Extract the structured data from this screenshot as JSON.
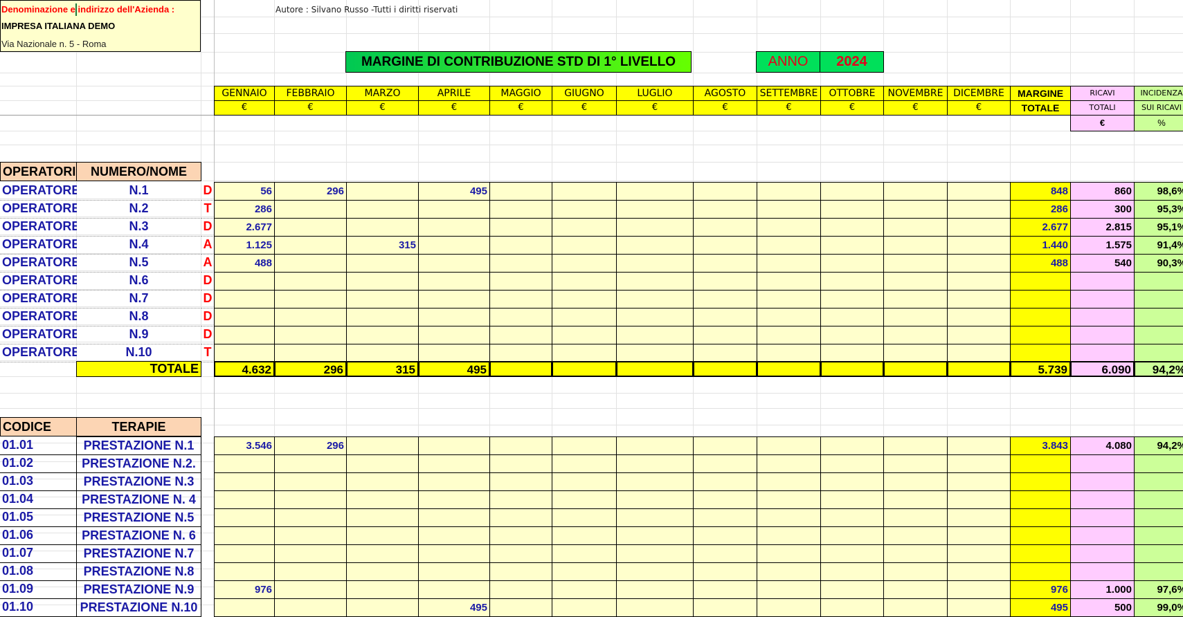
{
  "company": {
    "label": "Denominazione e indirizzo dell'Azienda :",
    "name": "IMPRESA ITALIANA DEMO",
    "address": "Via Nazionale n. 5 - Roma"
  },
  "author": "Autore : Silvano Russo -Tutti i diritti riservati",
  "title": "MARGINE DI CONTRIBUZIONE STD DI 1° LIVELLO",
  "year": {
    "label": "ANNO",
    "value": "2024"
  },
  "months": [
    "GENNAIO",
    "FEBBRAIO",
    "MARZO",
    "APRILE",
    "MAGGIO",
    "GIUGNO",
    "LUGLIO",
    "AGOSTO",
    "SETTEMBRE",
    "OTTOBRE",
    "NOVEMBRE",
    "DICEMBRE"
  ],
  "currency": "€",
  "margin_header": {
    "line1": "MARGINE",
    "line2": "TOTALE"
  },
  "revenue_header": {
    "line1": "RICAVI",
    "line2": "TOTALI",
    "unit": "€"
  },
  "incidence_header": {
    "line1": "INCIDENZA",
    "line2": "SUI RICAVI",
    "unit": "%"
  },
  "operators_section": {
    "headers": [
      "OPERATORI",
      "NUMERO/NOME"
    ],
    "rows": [
      {
        "type": "OPERATORE",
        "name": "N.1",
        "mark": "D",
        "months": [
          "56",
          "296",
          "",
          "495",
          "",
          "",
          "",
          "",
          "",
          "",
          "",
          ""
        ],
        "margin": "848",
        "revenue": "860",
        "incidence": "98,6%"
      },
      {
        "type": "OPERATORE",
        "name": "N.2",
        "mark": "T",
        "months": [
          "286",
          "",
          "",
          "",
          "",
          "",
          "",
          "",
          "",
          "",
          "",
          ""
        ],
        "margin": "286",
        "revenue": "300",
        "incidence": "95,3%"
      },
      {
        "type": "OPERATORE",
        "name": "N.3",
        "mark": "D",
        "months": [
          "2.677",
          "",
          "",
          "",
          "",
          "",
          "",
          "",
          "",
          "",
          "",
          ""
        ],
        "margin": "2.677",
        "revenue": "2.815",
        "incidence": "95,1%"
      },
      {
        "type": "OPERATORE",
        "name": "N.4",
        "mark": "A",
        "months": [
          "1.125",
          "",
          "315",
          "",
          "",
          "",
          "",
          "",
          "",
          "",
          "",
          ""
        ],
        "margin": "1.440",
        "revenue": "1.575",
        "incidence": "91,4%"
      },
      {
        "type": "OPERATORE",
        "name": "N.5",
        "mark": "A",
        "months": [
          "488",
          "",
          "",
          "",
          "",
          "",
          "",
          "",
          "",
          "",
          "",
          ""
        ],
        "margin": "488",
        "revenue": "540",
        "incidence": "90,3%"
      },
      {
        "type": "OPERATORE",
        "name": "N.6",
        "mark": "D",
        "months": [
          "",
          "",
          "",
          "",
          "",
          "",
          "",
          "",
          "",
          "",
          "",
          ""
        ],
        "margin": "",
        "revenue": "",
        "incidence": ""
      },
      {
        "type": "OPERATORE",
        "name": "N.7",
        "mark": "D",
        "months": [
          "",
          "",
          "",
          "",
          "",
          "",
          "",
          "",
          "",
          "",
          "",
          ""
        ],
        "margin": "",
        "revenue": "",
        "incidence": ""
      },
      {
        "type": "OPERATORE",
        "name": "N.8",
        "mark": "D",
        "months": [
          "",
          "",
          "",
          "",
          "",
          "",
          "",
          "",
          "",
          "",
          "",
          ""
        ],
        "margin": "",
        "revenue": "",
        "incidence": ""
      },
      {
        "type": "OPERATORE",
        "name": "N.9",
        "mark": "D",
        "months": [
          "",
          "",
          "",
          "",
          "",
          "",
          "",
          "",
          "",
          "",
          "",
          ""
        ],
        "margin": "",
        "revenue": "",
        "incidence": ""
      },
      {
        "type": "OPERATORE",
        "name": "N.10",
        "mark": "T",
        "months": [
          "",
          "",
          "",
          "",
          "",
          "",
          "",
          "",
          "",
          "",
          "",
          ""
        ],
        "margin": "",
        "revenue": "",
        "incidence": ""
      }
    ],
    "total": {
      "label": "TOTALE",
      "months": [
        "4.632",
        "296",
        "315",
        "495",
        "",
        "",
        "",
        "",
        "",
        "",
        "",
        ""
      ],
      "margin": "5.739",
      "revenue": "6.090",
      "incidence": "94,2%"
    }
  },
  "therapies_section": {
    "headers": [
      "CODICE",
      "TERAPIE"
    ],
    "rows": [
      {
        "code": "01.01",
        "name": "PRESTAZIONE N.1",
        "months": [
          "3.546",
          "296",
          "",
          "",
          "",
          "",
          "",
          "",
          "",
          "",
          "",
          ""
        ],
        "margin": "3.843",
        "revenue": "4.080",
        "incidence": "94,2%"
      },
      {
        "code": "01.02",
        "name": "PRESTAZIONE N.2.",
        "months": [
          "",
          "",
          "",
          "",
          "",
          "",
          "",
          "",
          "",
          "",
          "",
          ""
        ],
        "margin": "",
        "revenue": "",
        "incidence": ""
      },
      {
        "code": "01.03",
        "name": "PRESTAZIONE N.3",
        "months": [
          "",
          "",
          "",
          "",
          "",
          "",
          "",
          "",
          "",
          "",
          "",
          ""
        ],
        "margin": "",
        "revenue": "",
        "incidence": ""
      },
      {
        "code": "01.04",
        "name": "PRESTAZIONE N. 4",
        "months": [
          "",
          "",
          "",
          "",
          "",
          "",
          "",
          "",
          "",
          "",
          "",
          ""
        ],
        "margin": "",
        "revenue": "",
        "incidence": ""
      },
      {
        "code": "01.05",
        "name": "PRESTAZIONE N.5",
        "months": [
          "",
          "",
          "",
          "",
          "",
          "",
          "",
          "",
          "",
          "",
          "",
          ""
        ],
        "margin": "",
        "revenue": "",
        "incidence": ""
      },
      {
        "code": "01.06",
        "name": "PRESTAZIONE N. 6",
        "months": [
          "",
          "",
          "",
          "",
          "",
          "",
          "",
          "",
          "",
          "",
          "",
          ""
        ],
        "margin": "",
        "revenue": "",
        "incidence": ""
      },
      {
        "code": "01.07",
        "name": "PRESTAZIONE N.7",
        "months": [
          "",
          "",
          "",
          "",
          "",
          "",
          "",
          "",
          "",
          "",
          "",
          ""
        ],
        "margin": "",
        "revenue": "",
        "incidence": ""
      },
      {
        "code": "01.08",
        "name": "PRESTAZIONE N.8",
        "months": [
          "",
          "",
          "",
          "",
          "",
          "",
          "",
          "",
          "",
          "",
          "",
          ""
        ],
        "margin": "",
        "revenue": "",
        "incidence": ""
      },
      {
        "code": "01.09",
        "name": "PRESTAZIONE N.9",
        "months": [
          "976",
          "",
          "",
          "",
          "",
          "",
          "",
          "",
          "",
          "",
          "",
          ""
        ],
        "margin": "976",
        "revenue": "1.000",
        "incidence": "97,6%"
      },
      {
        "code": "01.10",
        "name": "PRESTAZIONE N.10",
        "months": [
          "",
          "",
          "",
          "495",
          "",
          "",
          "",
          "",
          "",
          "",
          "",
          ""
        ],
        "margin": "495",
        "revenue": "500",
        "incidence": "99,0%"
      }
    ]
  },
  "colors": {
    "yellow": "#ffff00",
    "light_yellow": "#ffffcc",
    "pink": "#ffccff",
    "light_green": "#ccff99",
    "orange": "#fcd5b4",
    "title_green": "#66ff00",
    "year_green": "#00e05a",
    "data_blue": "#1a1aa6",
    "accent_red": "#ff0000"
  }
}
